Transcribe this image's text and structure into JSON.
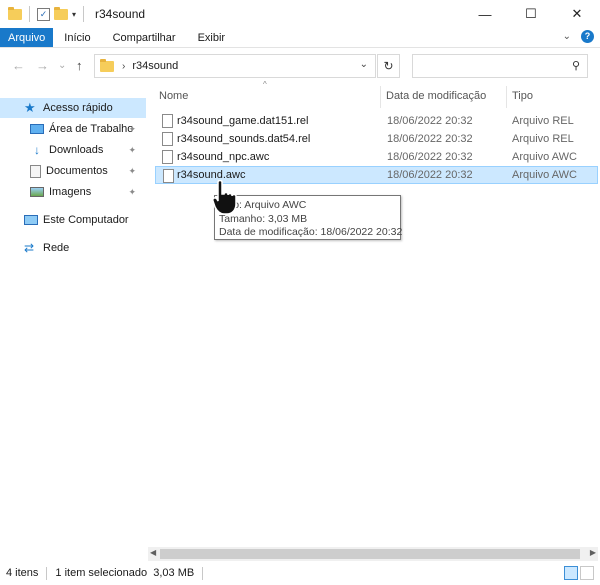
{
  "titlebar": {
    "title": "r34sound",
    "qat_dropdown": "▾",
    "minimize": "—",
    "maximize": "☐",
    "close": "✕"
  },
  "ribbon": {
    "tabs": [
      "Arquivo",
      "Início",
      "Compartilhar",
      "Exibir"
    ],
    "expand": "⌄",
    "help": "?"
  },
  "nav": {
    "back": "←",
    "forward": "→",
    "recent": "⌄",
    "up": "↑",
    "breadcrumb": "r34sound",
    "address_dropdown": "⌄",
    "refresh": "↻",
    "search_placeholder": "",
    "search_icon": "⚲"
  },
  "sidebar": {
    "items": [
      {
        "label": "Acesso rápido",
        "icon": "star-icon",
        "pinned": false
      },
      {
        "label": "Área de Trabalho",
        "icon": "desktop-icon",
        "pinned": true
      },
      {
        "label": "Downloads",
        "icon": "download-icon",
        "pinned": true
      },
      {
        "label": "Documentos",
        "icon": "documents-icon",
        "pinned": true
      },
      {
        "label": "Imagens",
        "icon": "pictures-icon",
        "pinned": true
      },
      {
        "label": "Este Computador",
        "icon": "computer-icon",
        "pinned": false
      },
      {
        "label": "Rede",
        "icon": "network-icon",
        "pinned": false
      }
    ],
    "pin_glyph": "📌"
  },
  "filelist": {
    "columns": [
      "Nome",
      "Data de modificação",
      "Tipo"
    ],
    "rows": [
      {
        "name": "r34sound_game.dat151.rel",
        "date": "18/06/2022 20:32",
        "type": "Arquivo REL"
      },
      {
        "name": "r34sound_sounds.dat54.rel",
        "date": "18/06/2022 20:32",
        "type": "Arquivo REL"
      },
      {
        "name": "r34sound_npc.awc",
        "date": "18/06/2022 20:32",
        "type": "Arquivo AWC"
      },
      {
        "name": "r34sound.awc",
        "date": "18/06/2022 20:32",
        "type": "Arquivo AWC"
      }
    ],
    "selected_index": 3
  },
  "tooltip": {
    "line1": "Tipo: Arquivo AWC",
    "line2": "Tamanho: 3,03 MB",
    "line3": "Data de modificação: 18/06/2022 20:32"
  },
  "status": {
    "items": "4 itens",
    "selection": "1 item selecionado  3,03 MB"
  },
  "colors": {
    "accent": "#1979ca",
    "selection_bg": "#cce8ff",
    "selection_border": "#99d1ff"
  }
}
